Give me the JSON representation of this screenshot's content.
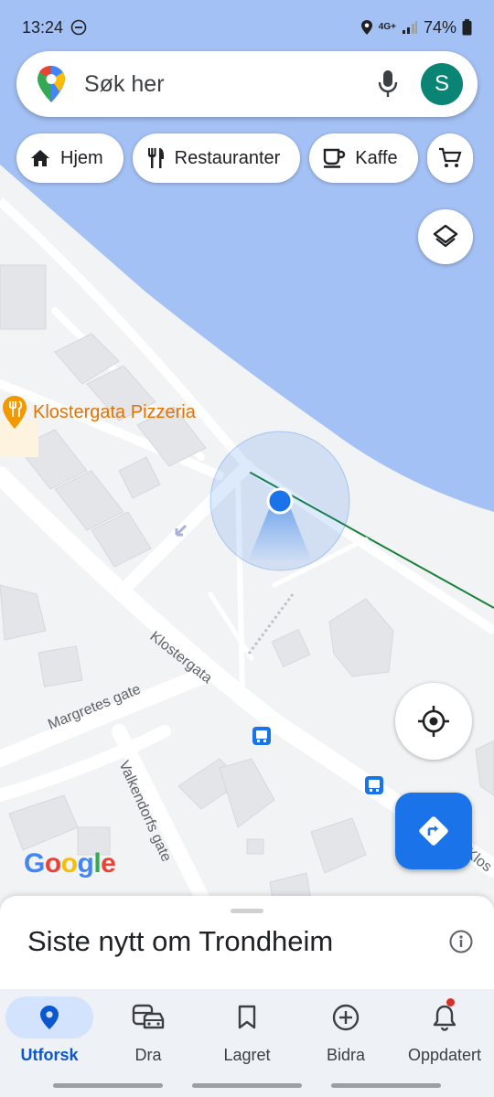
{
  "status_bar": {
    "time": "13:24",
    "network": "4G+",
    "battery": "74%"
  },
  "search": {
    "placeholder": "Søk her",
    "avatar_letter": "S"
  },
  "chips": [
    {
      "label": "Hjem",
      "icon": "home-icon"
    },
    {
      "label": "Restauranter",
      "icon": "restaurant-icon"
    },
    {
      "label": "Kaffe",
      "icon": "coffee-icon"
    },
    {
      "label": "",
      "icon": "cart-icon"
    }
  ],
  "map": {
    "poi_label": "Klostergata Pizzeria",
    "street_labels": [
      "Klostergata",
      "Margretes gate",
      "Valkendorfs gate",
      "Klos"
    ],
    "google_logo": "Google",
    "colors": {
      "water": "#a4c1f5",
      "land": "#f2f3f5",
      "road": "#ffffff",
      "building": "#e4e5e8",
      "poi": "#e37400",
      "accent": "#1a73e8"
    }
  },
  "sheet": {
    "title": "Siste nytt om Trondheim"
  },
  "nav": {
    "items": [
      {
        "label": "Utforsk",
        "icon": "explore-pin-icon",
        "active": true
      },
      {
        "label": "Dra",
        "icon": "commute-icon",
        "active": false
      },
      {
        "label": "Lagret",
        "icon": "bookmark-icon",
        "active": false
      },
      {
        "label": "Bidra",
        "icon": "add-circle-icon",
        "active": false
      },
      {
        "label": "Oppdatert",
        "icon": "bell-icon",
        "active": false
      }
    ]
  }
}
